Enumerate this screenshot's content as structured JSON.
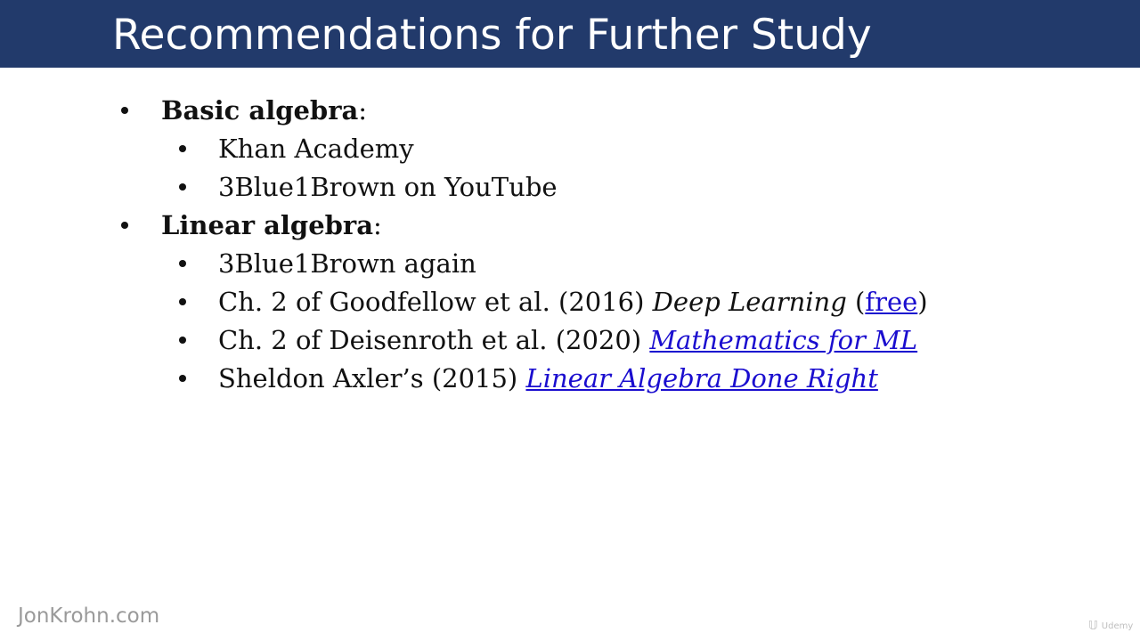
{
  "slide": {
    "title": "Recommendations for Further Study",
    "colors": {
      "title_bar": "#223a6b",
      "title_text": "#ffffff",
      "body_text": "#111111",
      "link": "#1a0dcf",
      "footer": "#9a9a9a"
    }
  },
  "items": {
    "basic": {
      "heading": "Basic algebra",
      "colon": ":",
      "sub": [
        "Khan Academy",
        "3Blue1Brown on YouTube"
      ]
    },
    "linear": {
      "heading": "Linear algebra",
      "colon": ":",
      "again": "3Blue1Brown again",
      "goodfellow": {
        "prefix": "Ch. 2 of Goodfellow et al. (2016) ",
        "book": "Deep Learning",
        "paren_open": " (",
        "link": "free",
        "paren_close": ")"
      },
      "deisenroth": {
        "prefix": "Ch. 2 of Deisenroth et al. (2020) ",
        "link": "Mathematics for ML"
      },
      "axler": {
        "prefix": "Sheldon Axler’s (2015) ",
        "link": "Linear Algebra Done Right"
      }
    }
  },
  "footer": {
    "brand": "JonKrohn.com",
    "watermark": "Udemy",
    "watermark_icon": "udemy-logo-icon"
  }
}
